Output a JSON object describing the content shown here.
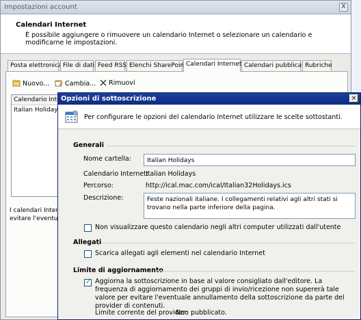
{
  "background_window": {
    "title": "Impostazioni account",
    "close": "X",
    "header_title": "Calendari Internet",
    "header_desc": "È possibile aggiungere o rimuovere un calendario Internet o selezionare un calendario e modificarne le impostazioni.",
    "tabs": [
      "Posta elettronica",
      "File di dati",
      "Feed RSS",
      "Elenchi SharePoint",
      "Calendari Internet",
      "Calendari pubblicati",
      "Rubriche"
    ],
    "active_tab": "Calendari Internet",
    "toolbar": {
      "new": "Nuovo...",
      "change": "Cambia...",
      "remove": "Rimuovi"
    },
    "list_header": "Calendario Interr",
    "list_items": [
      "Italian Holidays"
    ],
    "note_lines": [
      "I calendari Intern",
      "evitare l'eventual"
    ]
  },
  "dialog": {
    "title": "Opzioni di sottoscrizione",
    "close": "×",
    "intro": "Per configurare le opzioni del calendario Internet utilizzare le scelte sottostanti.",
    "general": {
      "heading": "Generali",
      "folder_label": "Nome cartella:",
      "folder_value": "Italian Holidays",
      "calendar_label": "Calendario Internet:",
      "calendar_value": "Italian Holidays",
      "path_label": "Percorso:",
      "path_value": "http://ical.mac.com/ical/Italian32Holidays.ics",
      "desc_label": "Descrizione:",
      "desc_value": "Feste nazionali italiane. I collegamenti relativi agli altri stati si trovano nella parte inferiore della pagina.",
      "no_display_label": "Non visualizzare questo calendario negli altri computer utilizzati dall'utente",
      "no_display_checked": false
    },
    "attachments": {
      "heading": "Allegati",
      "download_label": "Scarica allegati agli elementi nel calendario Internet",
      "download_checked": false
    },
    "update_limit": {
      "heading": "Limite di aggiornamento",
      "update_label": "Aggiorna la sottoscrizione in base al valore consigliato dall'editore. La frequenza di aggiornamento dei gruppi di invio/ricezione non supererà tale valore per evitare l'eventuale annullamento della sottoscrizione da parte del provider di contenuti.",
      "update_checked": true,
      "provider_limit_label": "Limite corrente del provider:",
      "provider_limit_value": "Non pubblicato."
    }
  }
}
